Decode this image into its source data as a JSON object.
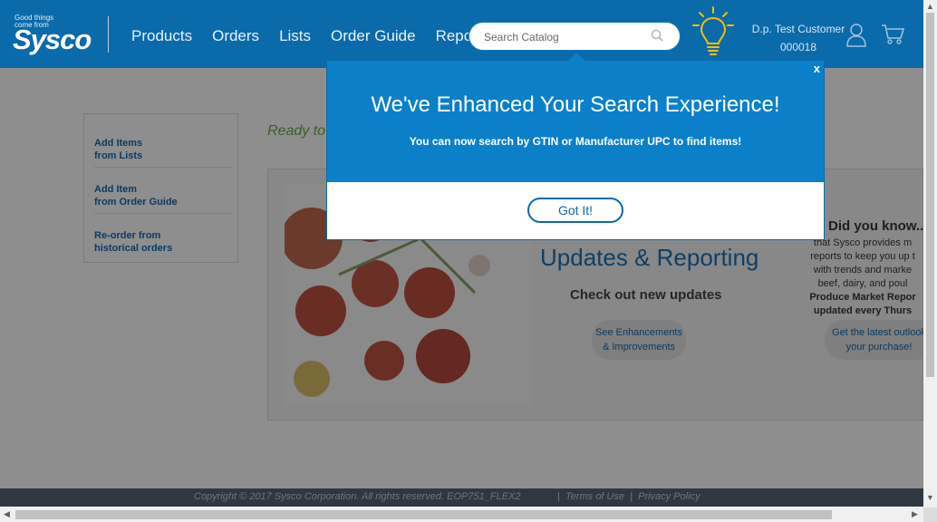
{
  "header": {
    "logo_tagline": "Good things come from",
    "logo_brand": "Sysco",
    "nav": [
      "Products",
      "Orders",
      "Lists",
      "Order Guide",
      "Reports"
    ],
    "search_placeholder": "Search Catalog",
    "customer_name": "D.p. Test Customer",
    "customer_number": "000018"
  },
  "sidebar": {
    "items": [
      {
        "line1": "Add Items",
        "line2": "from Lists"
      },
      {
        "line1": "Add Item",
        "line2": "from Order Guide"
      },
      {
        "line1": "Re-order from",
        "line2": "historical orders"
      }
    ]
  },
  "main": {
    "ready_text": "Ready to"
  },
  "promo": {
    "heading": "Updates & Reporting",
    "subheading": "Check out new updates",
    "button1_line1": "See Enhancements",
    "button1_line2": "& Improvements",
    "did_know_title": "Did you know...",
    "did_know_line1": "that Sysco provides m",
    "did_know_line2": "reports to keep you up t",
    "did_know_line3": "with trends and marke",
    "did_know_line4": "beef, dairy, and poul",
    "did_know_line5": "Produce Market Repor",
    "did_know_line6": "updated every Thurs",
    "button2_line1": "Get the latest outlook",
    "button2_line2": "your purchase!"
  },
  "modal": {
    "close_label": "x",
    "title": "We've Enhanced Your Search Experience!",
    "message": "You can now search by GTIN or Manufacturer UPC to find items!",
    "button_label": "Got It!"
  },
  "footer": {
    "copyright": "Copyright © 2017 Sysco Corporation. All rights reserved. EOP751_FLEX2",
    "separator": "|",
    "terms": "Terms of Use",
    "privacy": "Privacy Policy"
  },
  "colors": {
    "header_bg": "#0b6aa9",
    "modal_top": "#0b80c9",
    "overlay": "#8e8e8e",
    "footer_bg": "#2e3742"
  },
  "icons": [
    "search-icon",
    "lightbulb-icon",
    "user-icon",
    "cart-icon",
    "close-icon"
  ]
}
